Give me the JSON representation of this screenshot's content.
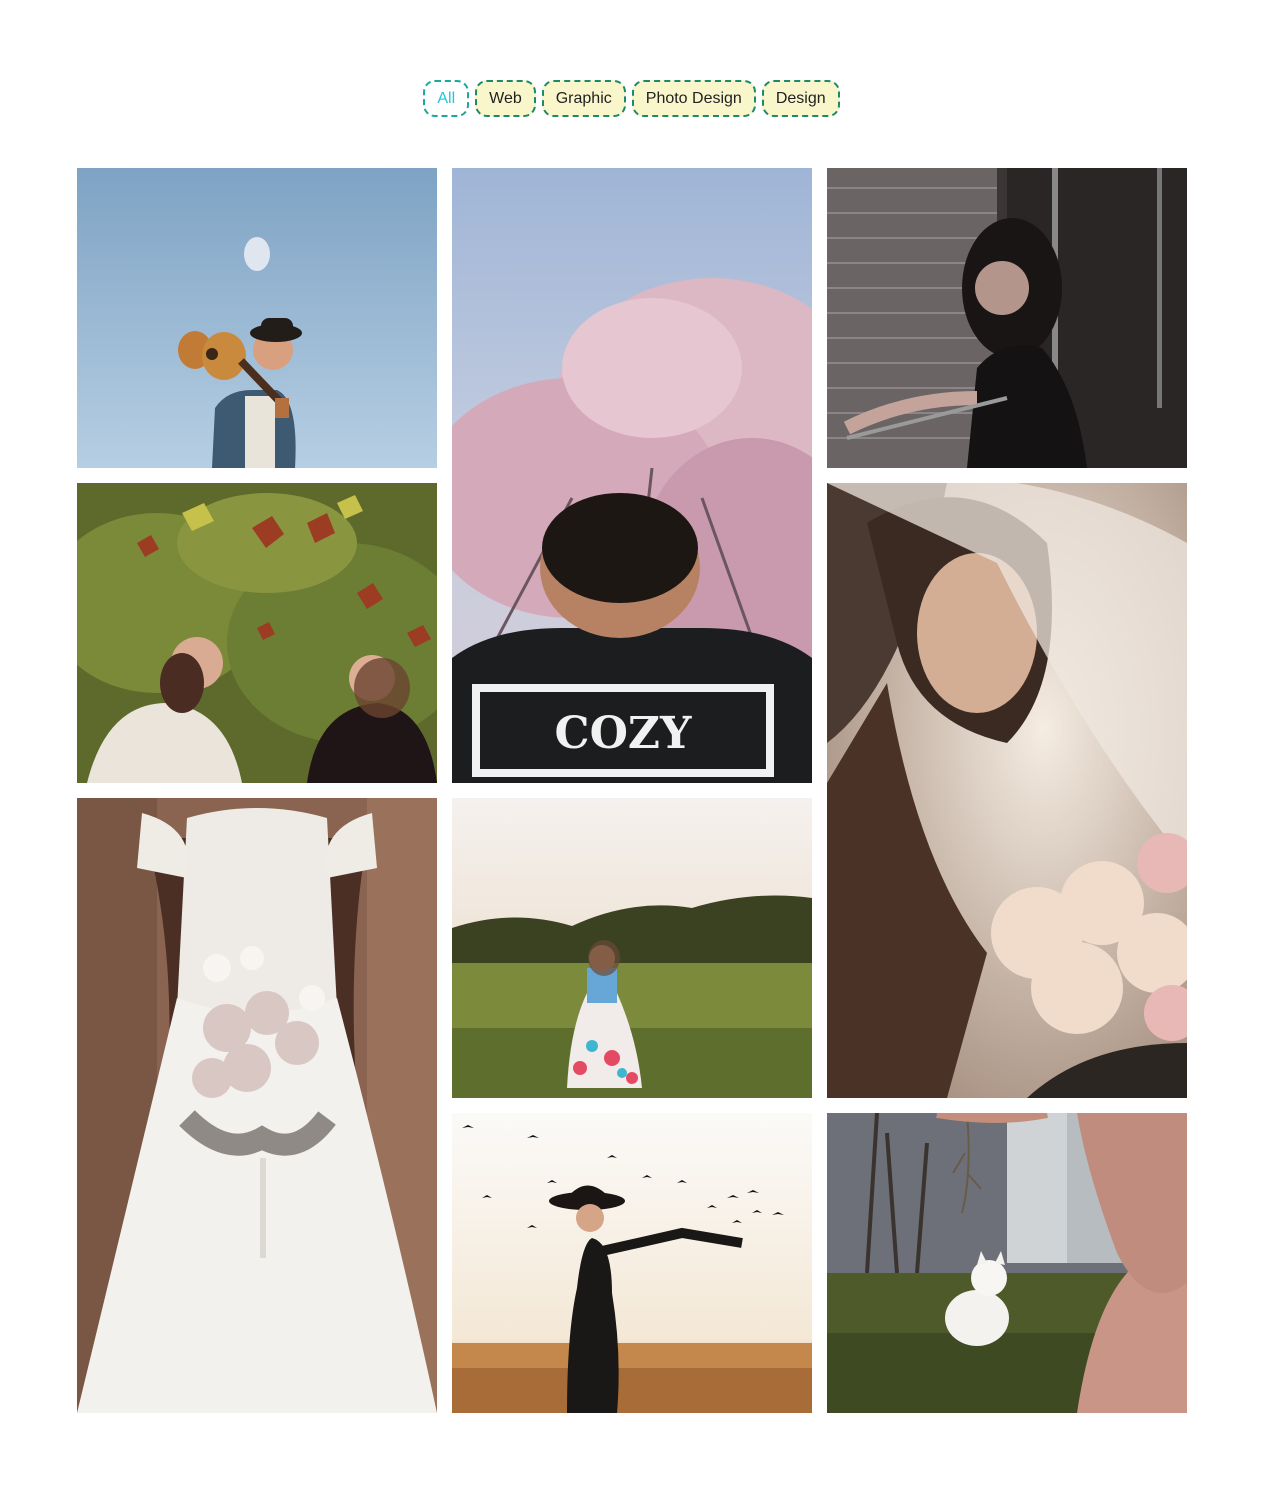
{
  "filters": [
    {
      "label": "All",
      "active": true
    },
    {
      "label": "Web",
      "active": false
    },
    {
      "label": "Graphic",
      "active": false
    },
    {
      "label": "Photo Design",
      "active": false
    },
    {
      "label": "Design",
      "active": false
    }
  ],
  "gallery": {
    "shirt_text": "COZY"
  },
  "colors": {
    "filter_border": "#1a8a6a",
    "filter_bg": "#faf6cc",
    "active_text": "#22c5d8"
  }
}
